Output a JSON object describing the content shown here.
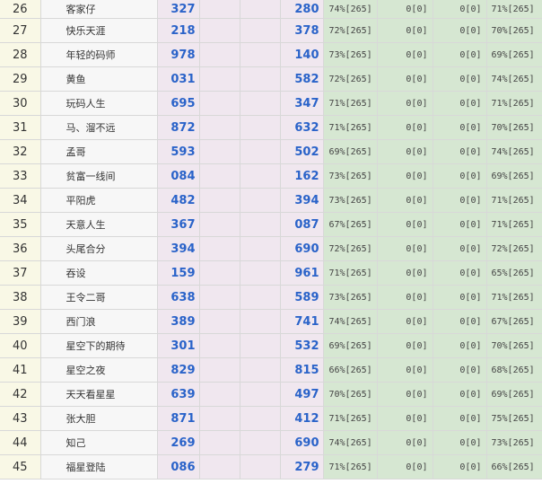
{
  "rows": [
    {
      "rank": "26",
      "name": "客家仔",
      "a": "327",
      "b": "280",
      "p1": "74%[265]",
      "z1": "0[0]",
      "z2": "0[0]",
      "p2": "71%[265]"
    },
    {
      "rank": "27",
      "name": "快乐天涯",
      "a": "218",
      "b": "378",
      "p1": "72%[265]",
      "z1": "0[0]",
      "z2": "0[0]",
      "p2": "70%[265]"
    },
    {
      "rank": "28",
      "name": "年轻的码师",
      "a": "978",
      "b": "140",
      "p1": "73%[265]",
      "z1": "0[0]",
      "z2": "0[0]",
      "p2": "69%[265]"
    },
    {
      "rank": "29",
      "name": "黄鱼",
      "a": "031",
      "b": "582",
      "p1": "72%[265]",
      "z1": "0[0]",
      "z2": "0[0]",
      "p2": "74%[265]"
    },
    {
      "rank": "30",
      "name": "玩码人生",
      "a": "695",
      "b": "347",
      "p1": "71%[265]",
      "z1": "0[0]",
      "z2": "0[0]",
      "p2": "71%[265]"
    },
    {
      "rank": "31",
      "name": "马、溜不远",
      "a": "872",
      "b": "632",
      "p1": "71%[265]",
      "z1": "0[0]",
      "z2": "0[0]",
      "p2": "70%[265]"
    },
    {
      "rank": "32",
      "name": "孟哥",
      "a": "593",
      "b": "502",
      "p1": "69%[265]",
      "z1": "0[0]",
      "z2": "0[0]",
      "p2": "74%[265]"
    },
    {
      "rank": "33",
      "name": "贫富一线间",
      "a": "084",
      "b": "162",
      "p1": "73%[265]",
      "z1": "0[0]",
      "z2": "0[0]",
      "p2": "69%[265]"
    },
    {
      "rank": "34",
      "name": "平阳虎",
      "a": "482",
      "b": "394",
      "p1": "73%[265]",
      "z1": "0[0]",
      "z2": "0[0]",
      "p2": "71%[265]"
    },
    {
      "rank": "35",
      "name": "天意人生",
      "a": "367",
      "b": "087",
      "p1": "67%[265]",
      "z1": "0[0]",
      "z2": "0[0]",
      "p2": "71%[265]"
    },
    {
      "rank": "36",
      "name": "头尾合分",
      "a": "394",
      "b": "690",
      "p1": "72%[265]",
      "z1": "0[0]",
      "z2": "0[0]",
      "p2": "72%[265]"
    },
    {
      "rank": "37",
      "name": "吞设",
      "a": "159",
      "b": "961",
      "p1": "71%[265]",
      "z1": "0[0]",
      "z2": "0[0]",
      "p2": "65%[265]"
    },
    {
      "rank": "38",
      "name": "王令二哥",
      "a": "638",
      "b": "589",
      "p1": "73%[265]",
      "z1": "0[0]",
      "z2": "0[0]",
      "p2": "71%[265]"
    },
    {
      "rank": "39",
      "name": "西门浪",
      "a": "389",
      "b": "741",
      "p1": "74%[265]",
      "z1": "0[0]",
      "z2": "0[0]",
      "p2": "67%[265]"
    },
    {
      "rank": "40",
      "name": "星空下的期待",
      "a": "301",
      "b": "532",
      "p1": "69%[265]",
      "z1": "0[0]",
      "z2": "0[0]",
      "p2": "70%[265]"
    },
    {
      "rank": "41",
      "name": "星空之夜",
      "a": "829",
      "b": "815",
      "p1": "66%[265]",
      "z1": "0[0]",
      "z2": "0[0]",
      "p2": "68%[265]"
    },
    {
      "rank": "42",
      "name": "天天看星星",
      "a": "639",
      "b": "497",
      "p1": "70%[265]",
      "z1": "0[0]",
      "z2": "0[0]",
      "p2": "69%[265]"
    },
    {
      "rank": "43",
      "name": "张大胆",
      "a": "871",
      "b": "412",
      "p1": "71%[265]",
      "z1": "0[0]",
      "z2": "0[0]",
      "p2": "75%[265]"
    },
    {
      "rank": "44",
      "name": "知己",
      "a": "269",
      "b": "690",
      "p1": "74%[265]",
      "z1": "0[0]",
      "z2": "0[0]",
      "p2": "73%[265]"
    },
    {
      "rank": "45",
      "name": "福星登陆",
      "a": "086",
      "b": "279",
      "p1": "71%[265]",
      "z1": "0[0]",
      "z2": "0[0]",
      "p2": "66%[265]"
    }
  ]
}
